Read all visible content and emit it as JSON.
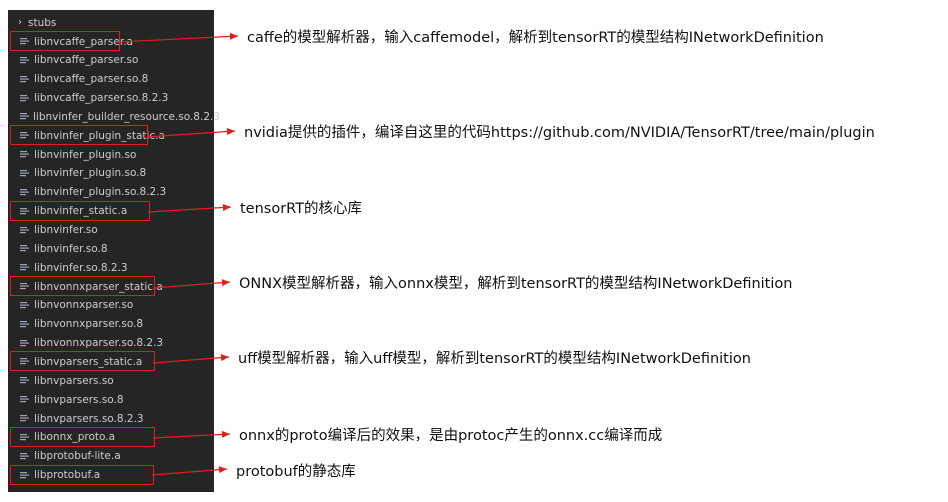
{
  "explorer": {
    "folder": "stubs",
    "files": [
      "libnvcaffe_parser.a",
      "libnvcaffe_parser.so",
      "libnvcaffe_parser.so.8",
      "libnvcaffe_parser.so.8.2.3",
      "libnvinfer_builder_resource.so.8.2.3",
      "libnvinfer_plugin_static.a",
      "libnvinfer_plugin.so",
      "libnvinfer_plugin.so.8",
      "libnvinfer_plugin.so.8.2.3",
      "libnvinfer_static.a",
      "libnvinfer.so",
      "libnvinfer.so.8",
      "libnvinfer.so.8.2.3",
      "libnvonnxparser_static.a",
      "libnvonnxparser.so",
      "libnvonnxparser.so.8",
      "libnvonnxparser.so.8.2.3",
      "libnvparsers_static.a",
      "libnvparsers.so",
      "libnvparsers.so.8",
      "libnvparsers.so.8.2.3",
      "libonnx_proto.a",
      "libprotobuf-lite.a",
      "libprotobuf.a"
    ]
  },
  "annotations": [
    "caffe的模型解析器，输入caffemodel，解析到tensorRT的模型结构INetworkDefinition",
    "nvidia提供的插件，编译自这里的代码https://github.com/NVIDIA/TensorRT/tree/main/plugin",
    "tensorRT的核心库",
    "ONNX模型解析器，输入onnx模型，解析到tensorRT的模型结构INetworkDefinition",
    "uff模型解析器，输入uff模型，解析到tensorRT的模型结构INetworkDefinition",
    "onnx的proto编译后的效果，是由protoc产生的onnx.cc编译而成",
    "protobuf的静态库"
  ],
  "colors": {
    "explorer_bg": "#252526",
    "text": "#cccccc",
    "highlight": "#e0201c"
  },
  "icons": [
    "chevron-right-icon",
    "file-lines-icon",
    "arrow-right-icon"
  ]
}
